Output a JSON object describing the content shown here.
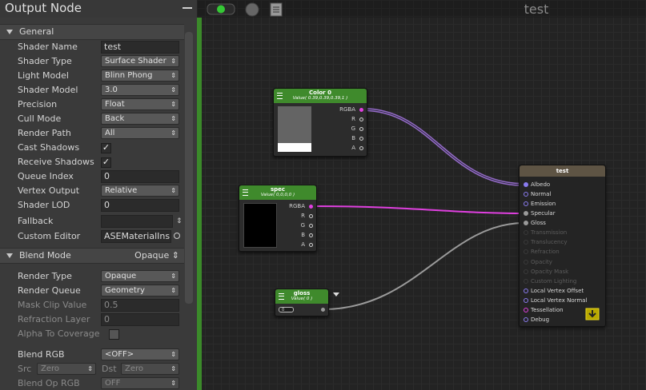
{
  "inspector": {
    "title": "Output Node",
    "general_label": "General",
    "rows": [
      {
        "label": "Shader Name",
        "kind": "field",
        "value": "test"
      },
      {
        "label": "Shader Type",
        "kind": "dropdown",
        "value": "Surface Shader"
      },
      {
        "label": "Light Model",
        "kind": "dropdown",
        "value": "Blinn Phong"
      },
      {
        "label": "Shader Model",
        "kind": "dropdown",
        "value": "3.0"
      },
      {
        "label": "Precision",
        "kind": "dropdown",
        "value": "Float"
      },
      {
        "label": "Cull Mode",
        "kind": "dropdown",
        "value": "Back"
      },
      {
        "label": "Render Path",
        "kind": "dropdown",
        "value": "All"
      },
      {
        "label": "Cast Shadows",
        "kind": "check",
        "value": "✓"
      },
      {
        "label": "Receive Shadows",
        "kind": "check",
        "value": "✓"
      },
      {
        "label": "Queue Index",
        "kind": "field",
        "value": "0"
      },
      {
        "label": "Vertex Output",
        "kind": "dropdown",
        "value": "Relative"
      },
      {
        "label": "Shader LOD",
        "kind": "field",
        "value": "0"
      },
      {
        "label": "Fallback",
        "kind": "field",
        "value": ""
      },
      {
        "label": "Custom Editor",
        "kind": "field",
        "value": "ASEMaterialIns"
      }
    ],
    "blend_mode": {
      "label": "Blend Mode",
      "value": "Opaque"
    },
    "blend_rows": [
      {
        "label": "Render Type",
        "kind": "dropdown",
        "value": "Opaque"
      },
      {
        "label": "Render Queue",
        "kind": "dropdown",
        "value": "Geometry"
      },
      {
        "label": "Mask Clip Value",
        "kind": "field",
        "value": "0.5",
        "dim": true
      },
      {
        "label": "Refraction Layer",
        "kind": "field",
        "value": "0",
        "dim": true
      },
      {
        "label": "Alpha To Coverage",
        "kind": "check",
        "value": "",
        "dim": true
      },
      {
        "label": "Blend RGB",
        "kind": "dropdown",
        "value": "<OFF>"
      },
      {
        "label": "Blend Op RGB",
        "kind": "dropdown",
        "value": "OFF",
        "dim": true
      }
    ],
    "src_label": "Src",
    "src_value": "Zero",
    "dst_label": "Dst",
    "dst_value": "Zero",
    "dropdown_arrow": "⇕",
    "fallback_arrow": "⇕"
  },
  "canvas": {
    "title": "test",
    "nodes": {
      "color0": {
        "name": "Color 0",
        "value": "Value( 0.39,0.39,0.39,1 )",
        "swatch": "#646464",
        "ports": [
          "RGBA",
          "R",
          "G",
          "B",
          "A"
        ]
      },
      "spec": {
        "name": "spec",
        "value": "Value( 0,0,0,0 )",
        "swatch": "#000000",
        "ports": [
          "RGBA",
          "R",
          "G",
          "B",
          "A"
        ]
      },
      "gloss": {
        "name": "gloss",
        "value": "Value( 0 )",
        "field": "0"
      },
      "output": {
        "name": "test",
        "inputs": [
          "Albedo",
          "Normal",
          "Emission",
          "Specular",
          "Gloss",
          "Transmission",
          "Translucency",
          "Refraction",
          "Opacity",
          "Opacity Mask",
          "Custom Lighting",
          "Local Vertex Offset",
          "Local Vertex Normal",
          "Tessellation",
          "Debug"
        ]
      }
    }
  },
  "colors": {
    "accent_green": "#3f8a2c",
    "wire_purple": "#b07cf0",
    "wire_magenta": "#e040e0",
    "wire_gray": "#9a9a9a"
  }
}
